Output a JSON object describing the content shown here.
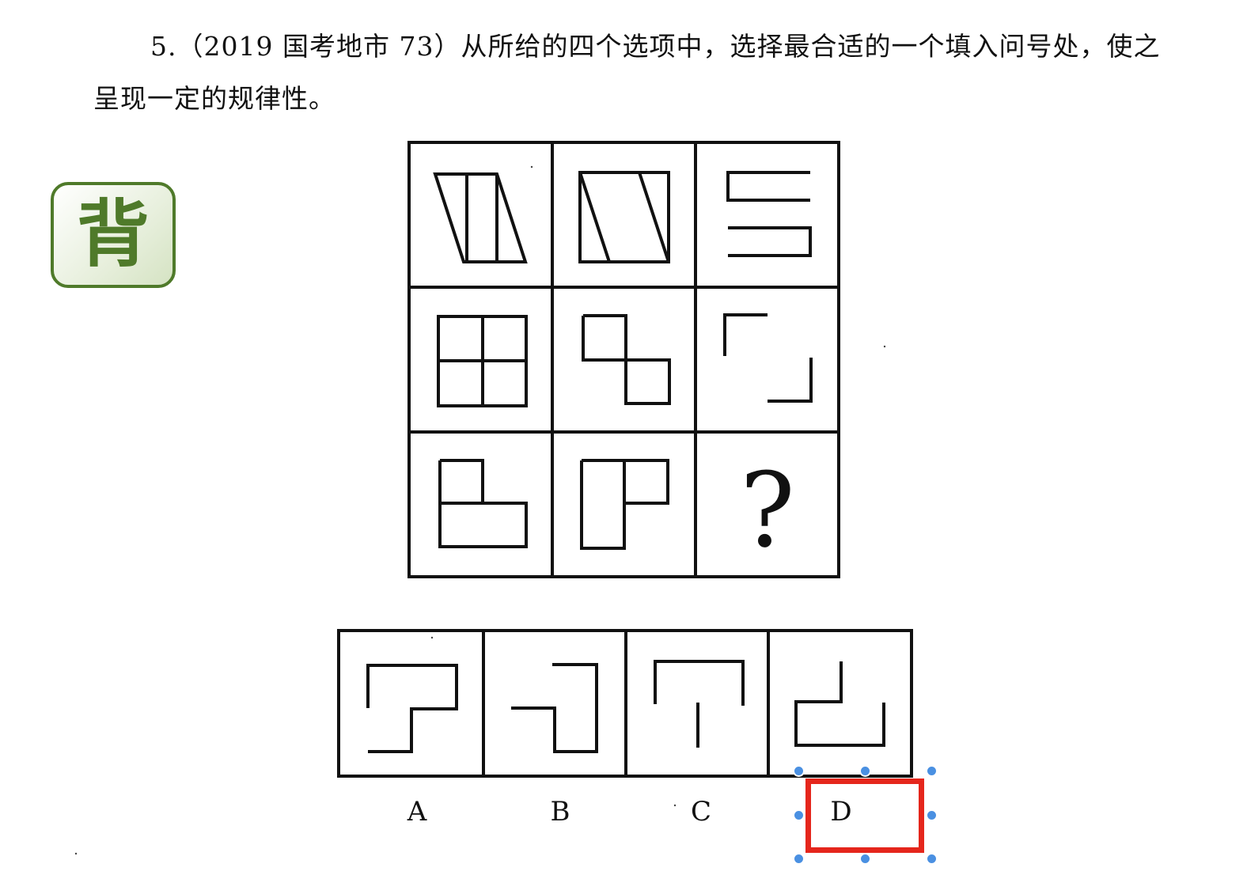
{
  "question": {
    "text": "5.（2019 国考地市 73）从所给的四个选项中，选择最合适的一个填入问号处，使之呈现一定的规律性。"
  },
  "badge": {
    "label": "背",
    "colors": {
      "border": "#4f7a2a",
      "text": "#4f7a2a"
    }
  },
  "grid": {
    "missing_symbol": "?"
  },
  "options": {
    "labels": [
      "A",
      "B",
      "C",
      "D"
    ],
    "selected": "D"
  },
  "selection": {
    "color": "#e5261c",
    "handle_color": "#4a90e2"
  }
}
